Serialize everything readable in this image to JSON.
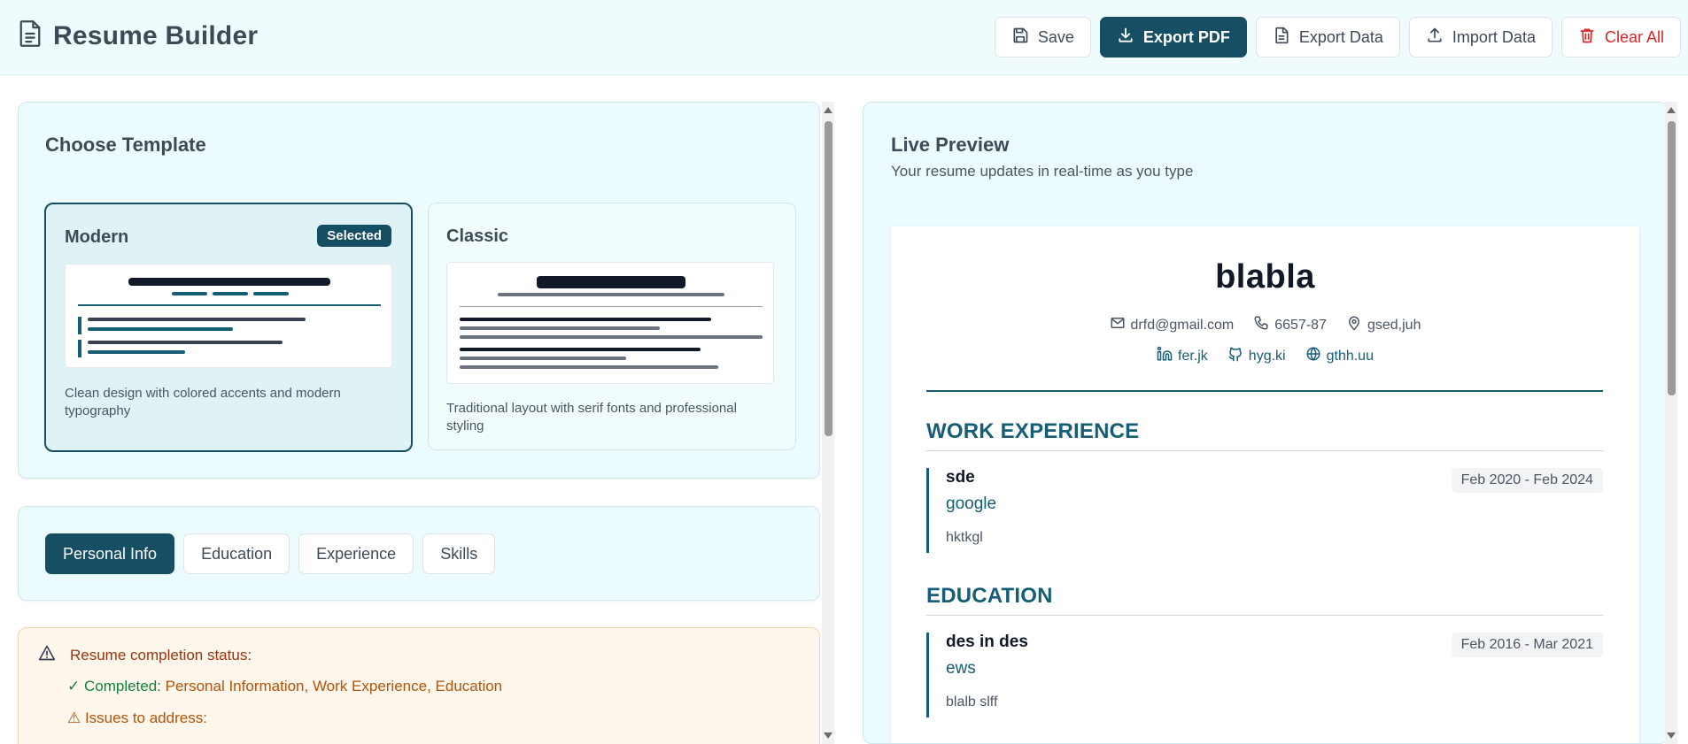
{
  "header": {
    "title": "Resume Builder",
    "buttons": {
      "save": "Save",
      "export_pdf": "Export PDF",
      "export_data": "Export Data",
      "import_data": "Import Data",
      "clear_all": "Clear All"
    }
  },
  "template_section": {
    "title": "Choose Template",
    "templates": [
      {
        "name": "Modern",
        "badge": "Selected",
        "description": "Clean design with colored accents and modern typography"
      },
      {
        "name": "Classic",
        "description": "Traditional layout with serif fonts and professional styling"
      }
    ]
  },
  "tabs": [
    "Personal Info",
    "Education",
    "Experience",
    "Skills"
  ],
  "status": {
    "heading": "Resume completion status:",
    "completed_label": "✓ Completed:",
    "completed_items": "Personal Information, Work Experience, Education",
    "issues_label": "⚠ Issues to address:"
  },
  "preview": {
    "title": "Live Preview",
    "subtitle": "Your resume updates in real-time as you type",
    "resume": {
      "name": "blabla",
      "email": "drfd@gmail.com",
      "phone": "6657-87",
      "location": "gsed,juh",
      "linkedin": "fer.jk",
      "github": "hyg.ki",
      "website": "gthh.uu",
      "sections": {
        "work_title": "WORK EXPERIENCE",
        "education_title": "EDUCATION"
      },
      "work": [
        {
          "title": "sde",
          "org": "google",
          "desc": "hktkgl",
          "dates": "Feb 2020 - Feb 2024"
        }
      ],
      "education": [
        {
          "title": "des in des",
          "org": "ews",
          "desc": "blalb slff",
          "dates": "Feb 2016 - Mar 2021"
        }
      ]
    }
  },
  "colors": {
    "primary": "#164e63",
    "accent": "#155e75",
    "danger": "#dc2626",
    "card_bg": "#ecfcfe",
    "warning_bg": "#fff6ec"
  }
}
